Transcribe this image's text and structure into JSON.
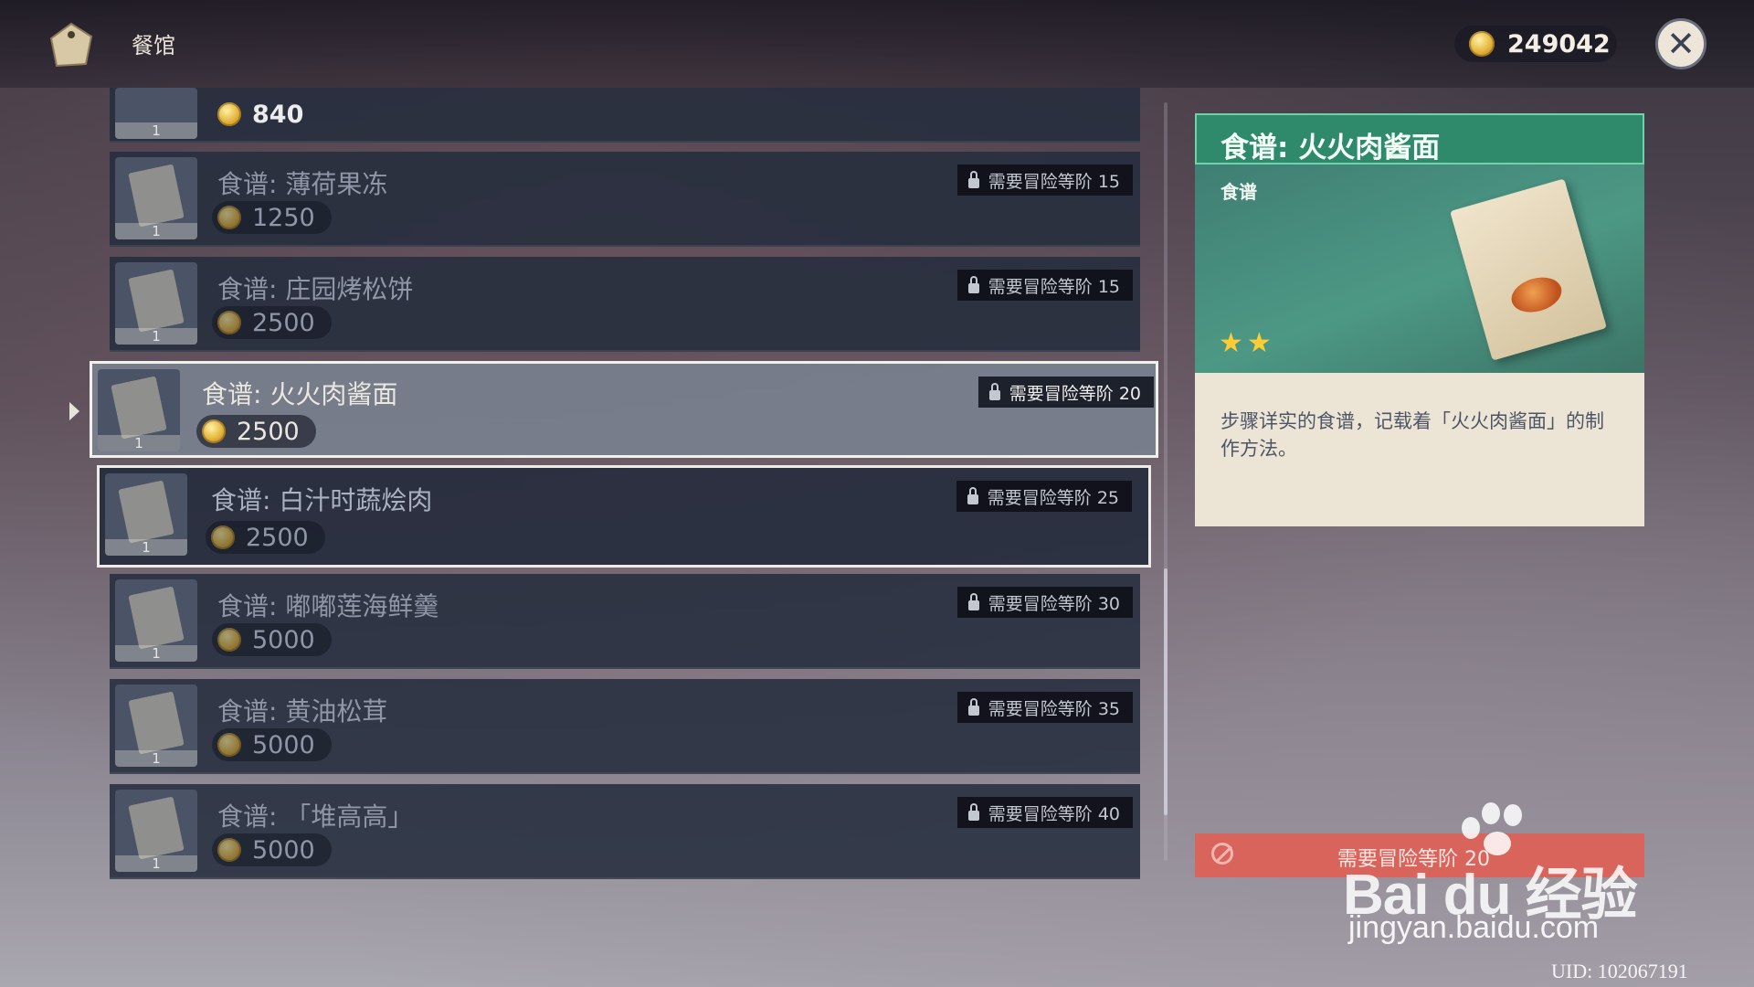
{
  "header": {
    "title": "餐馆",
    "currency": "249042"
  },
  "list": {
    "first_row": {
      "qty": "1",
      "price": "840"
    },
    "items": [
      {
        "name": "食谱: 薄荷果冻",
        "price": "1250",
        "lock": "需要冒险等阶 15",
        "qty": "1"
      },
      {
        "name": "食谱: 庄园烤松饼",
        "price": "2500",
        "lock": "需要冒险等阶 15",
        "qty": "1"
      },
      {
        "name": "食谱: 火火肉酱面",
        "price": "2500",
        "lock": "需要冒险等阶 20",
        "qty": "1"
      },
      {
        "name": "食谱: 白汁时蔬烩肉",
        "price": "2500",
        "lock": "需要冒险等阶 25",
        "qty": "1"
      },
      {
        "name": "食谱: 嘟嘟莲海鲜羹",
        "price": "5000",
        "lock": "需要冒险等阶 30",
        "qty": "1"
      },
      {
        "name": "食谱: 黄油松茸",
        "price": "5000",
        "lock": "需要冒险等阶 35",
        "qty": "1"
      },
      {
        "name": "食谱: 「堆高高」",
        "price": "5000",
        "lock": "需要冒险等阶 40",
        "qty": "1"
      }
    ]
  },
  "detail": {
    "title": "食谱: 火火肉酱面",
    "category": "食谱",
    "stars": "★★",
    "rarity": 2,
    "description": "步骤详实的食谱，记载着「火火肉酱面」的制作方法。"
  },
  "buy_button": {
    "label": "需要冒险等阶 20"
  },
  "watermark": {
    "brand": "Bai du 经验",
    "url": "jingyan.baidu.com"
  },
  "uid": "UID: 102067191"
}
